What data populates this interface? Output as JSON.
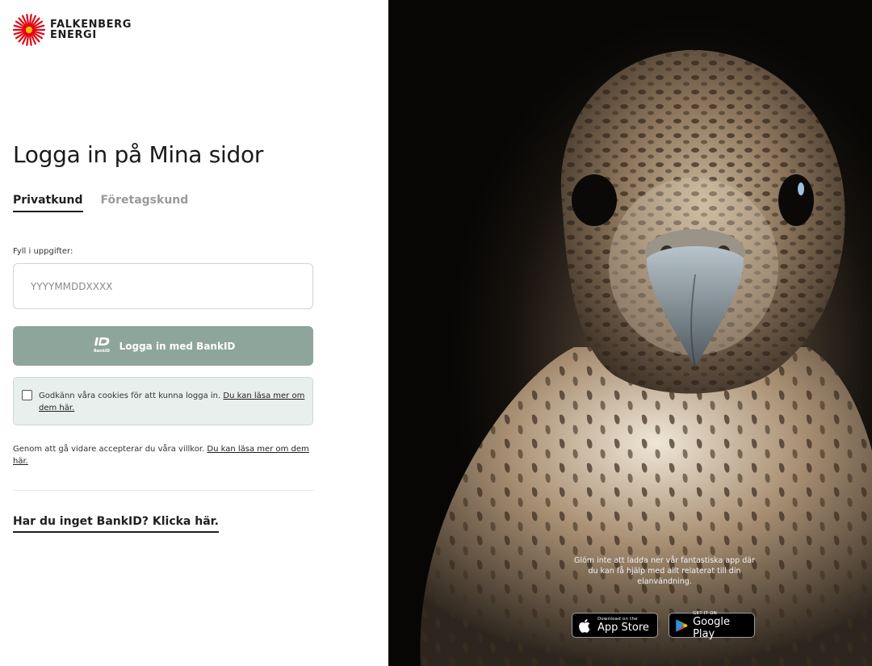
{
  "brand": {
    "line1": "FALKENBERG",
    "line2": "ENERGI",
    "accent_color": "#e30613"
  },
  "login": {
    "title": "Logga in på Mina sidor",
    "tabs": [
      {
        "label": "Privatkund",
        "active": true
      },
      {
        "label": "Företagskund",
        "active": false
      }
    ],
    "field_label": "Fyll i uppgifter:",
    "personal_number": {
      "value": "",
      "placeholder": "YYYYMMDDXXXX"
    },
    "bankid_button": {
      "label": "Logga in med BankID",
      "icon": "bankid-icon",
      "icon_caption": "BankID",
      "color": "#8ea59b"
    },
    "cookie": {
      "checked": false,
      "text": "Godkänn våra cookies för att kunna logga in.",
      "link": "Du kan läsa mer om dem här."
    },
    "terms": {
      "text": "Genom att gå vidare accepterar du våra villkor.",
      "link": "Du kan läsa mer om dem här."
    },
    "no_bankid_link": "Har du inget BankID? Klicka här."
  },
  "promo": {
    "text": "Glöm inte att ladda ner vår fantastiska app där du kan få hjälp med allt relaterat till din elanvändning.",
    "app_store": {
      "small": "Download on the",
      "big": "App Store",
      "icon": "apple-icon"
    },
    "google_play": {
      "small": "GET IT ON",
      "big": "Google Play",
      "icon": "google-play-icon"
    }
  }
}
